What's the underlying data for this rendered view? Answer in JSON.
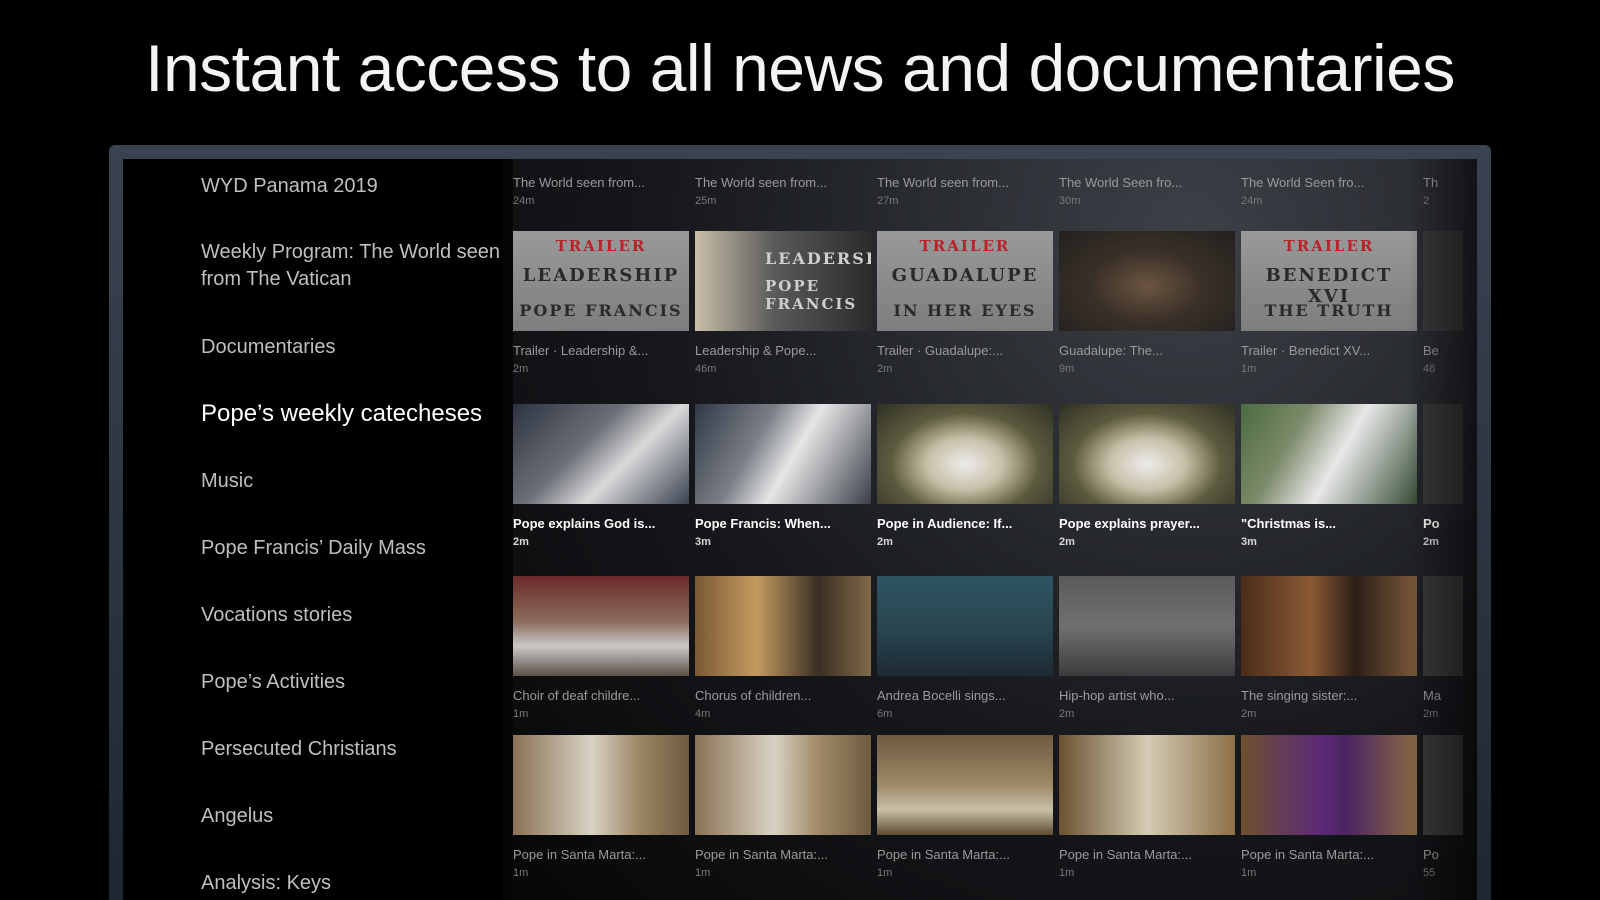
{
  "headline": "Instant access to all news and documentaries",
  "sidebar": {
    "items": [
      {
        "label": "WYD Panama 2019"
      },
      {
        "label": "Weekly Program: The World seen from The Vatican"
      },
      {
        "label": "Documentaries"
      },
      {
        "label": "Pope’s weekly catecheses"
      },
      {
        "label": "Music"
      },
      {
        "label": "Pope Francis’ Daily Mass"
      },
      {
        "label": "Vocations stories"
      },
      {
        "label": "Pope’s Activities"
      },
      {
        "label": "Persecuted Christians"
      },
      {
        "label": "Angelus"
      },
      {
        "label": "Analysis: Keys"
      }
    ]
  },
  "rows": [
    {
      "kind": "text-only",
      "cards": [
        {
          "title": "The World seen from...",
          "duration": "24m"
        },
        {
          "title": "The World seen from...",
          "duration": "25m"
        },
        {
          "title": "The World seen from...",
          "duration": "27m"
        },
        {
          "title": "The World Seen fro...",
          "duration": "30m"
        },
        {
          "title": "The World Seen fro...",
          "duration": "24m"
        },
        {
          "title": "Th",
          "duration": "2"
        }
      ]
    },
    {
      "kind": "documentaries",
      "cards": [
        {
          "title": "Trailer · Leadership &...",
          "duration": "2m",
          "thumb_text": [
            "TRAILER",
            "LEADERSHIP",
            "POPE FRANCIS"
          ],
          "thumb_style": "trailer"
        },
        {
          "title": "Leadership & Pope...",
          "duration": "46m",
          "thumb_text": [
            "LEADERSHIP",
            "POPE FRANCIS"
          ],
          "thumb_style": "dark"
        },
        {
          "title": "Trailer · Guadalupe:...",
          "duration": "2m",
          "thumb_text": [
            "TRAILER",
            "GUADALUPE",
            "IN HER EYES"
          ],
          "thumb_style": "trailer"
        },
        {
          "title": "Guadalupe: The...",
          "duration": "9m",
          "thumb_text": [],
          "thumb_style": "icon"
        },
        {
          "title": "Trailer · Benedict XV...",
          "duration": "1m",
          "thumb_text": [
            "TRAILER",
            "BENEDICT XVI",
            "THE TRUTH"
          ],
          "thumb_style": "trailer"
        },
        {
          "title": "Be",
          "duration": "48"
        }
      ]
    },
    {
      "kind": "focus",
      "cards": [
        {
          "title": "Pope explains God is...",
          "duration": "2m",
          "thumb_style": "crowd"
        },
        {
          "title": "Pope Francis: When...",
          "duration": "3m",
          "thumb_style": "crowd2"
        },
        {
          "title": "Pope in Audience: If...",
          "duration": "2m",
          "thumb_style": "audience"
        },
        {
          "title": "Pope explains prayer...",
          "duration": "2m",
          "thumb_style": "audience"
        },
        {
          "title": "\"Christmas is...",
          "duration": "3m",
          "thumb_style": "crowd3"
        },
        {
          "title": "Po",
          "duration": "2m"
        }
      ]
    },
    {
      "kind": "music",
      "cards": [
        {
          "title": "Choir of deaf childre...",
          "duration": "1m",
          "thumb_style": "choir"
        },
        {
          "title": "Chorus of children...",
          "duration": "4m",
          "thumb_style": "violin"
        },
        {
          "title": "Andrea Bocelli sings...",
          "duration": "6m",
          "thumb_style": "bocelli"
        },
        {
          "title": "Hip-hop artist who...",
          "duration": "2m",
          "thumb_style": "stairs"
        },
        {
          "title": "The singing sister:...",
          "duration": "2m",
          "thumb_style": "sister"
        },
        {
          "title": "Ma",
          "duration": "2m"
        }
      ]
    },
    {
      "kind": "mass",
      "cards": [
        {
          "title": "Pope in Santa Marta:...",
          "duration": "1m",
          "thumb_style": "mass"
        },
        {
          "title": "Pope in Santa Marta:...",
          "duration": "1m",
          "thumb_style": "mass"
        },
        {
          "title": "Pope in Santa Marta:...",
          "duration": "1m",
          "thumb_style": "mass2"
        },
        {
          "title": "Pope in Santa Marta:...",
          "duration": "1m",
          "thumb_style": "mass3"
        },
        {
          "title": "Pope in Santa Marta:...",
          "duration": "1m",
          "thumb_style": "purple"
        },
        {
          "title": "Po",
          "duration": "55"
        }
      ]
    }
  ],
  "colors": {
    "background": "#000000",
    "frame": "#2e3644",
    "active_text": "#ffffff",
    "inactive_text": "#bfbfbf",
    "trailer_red": "#b8232a"
  }
}
